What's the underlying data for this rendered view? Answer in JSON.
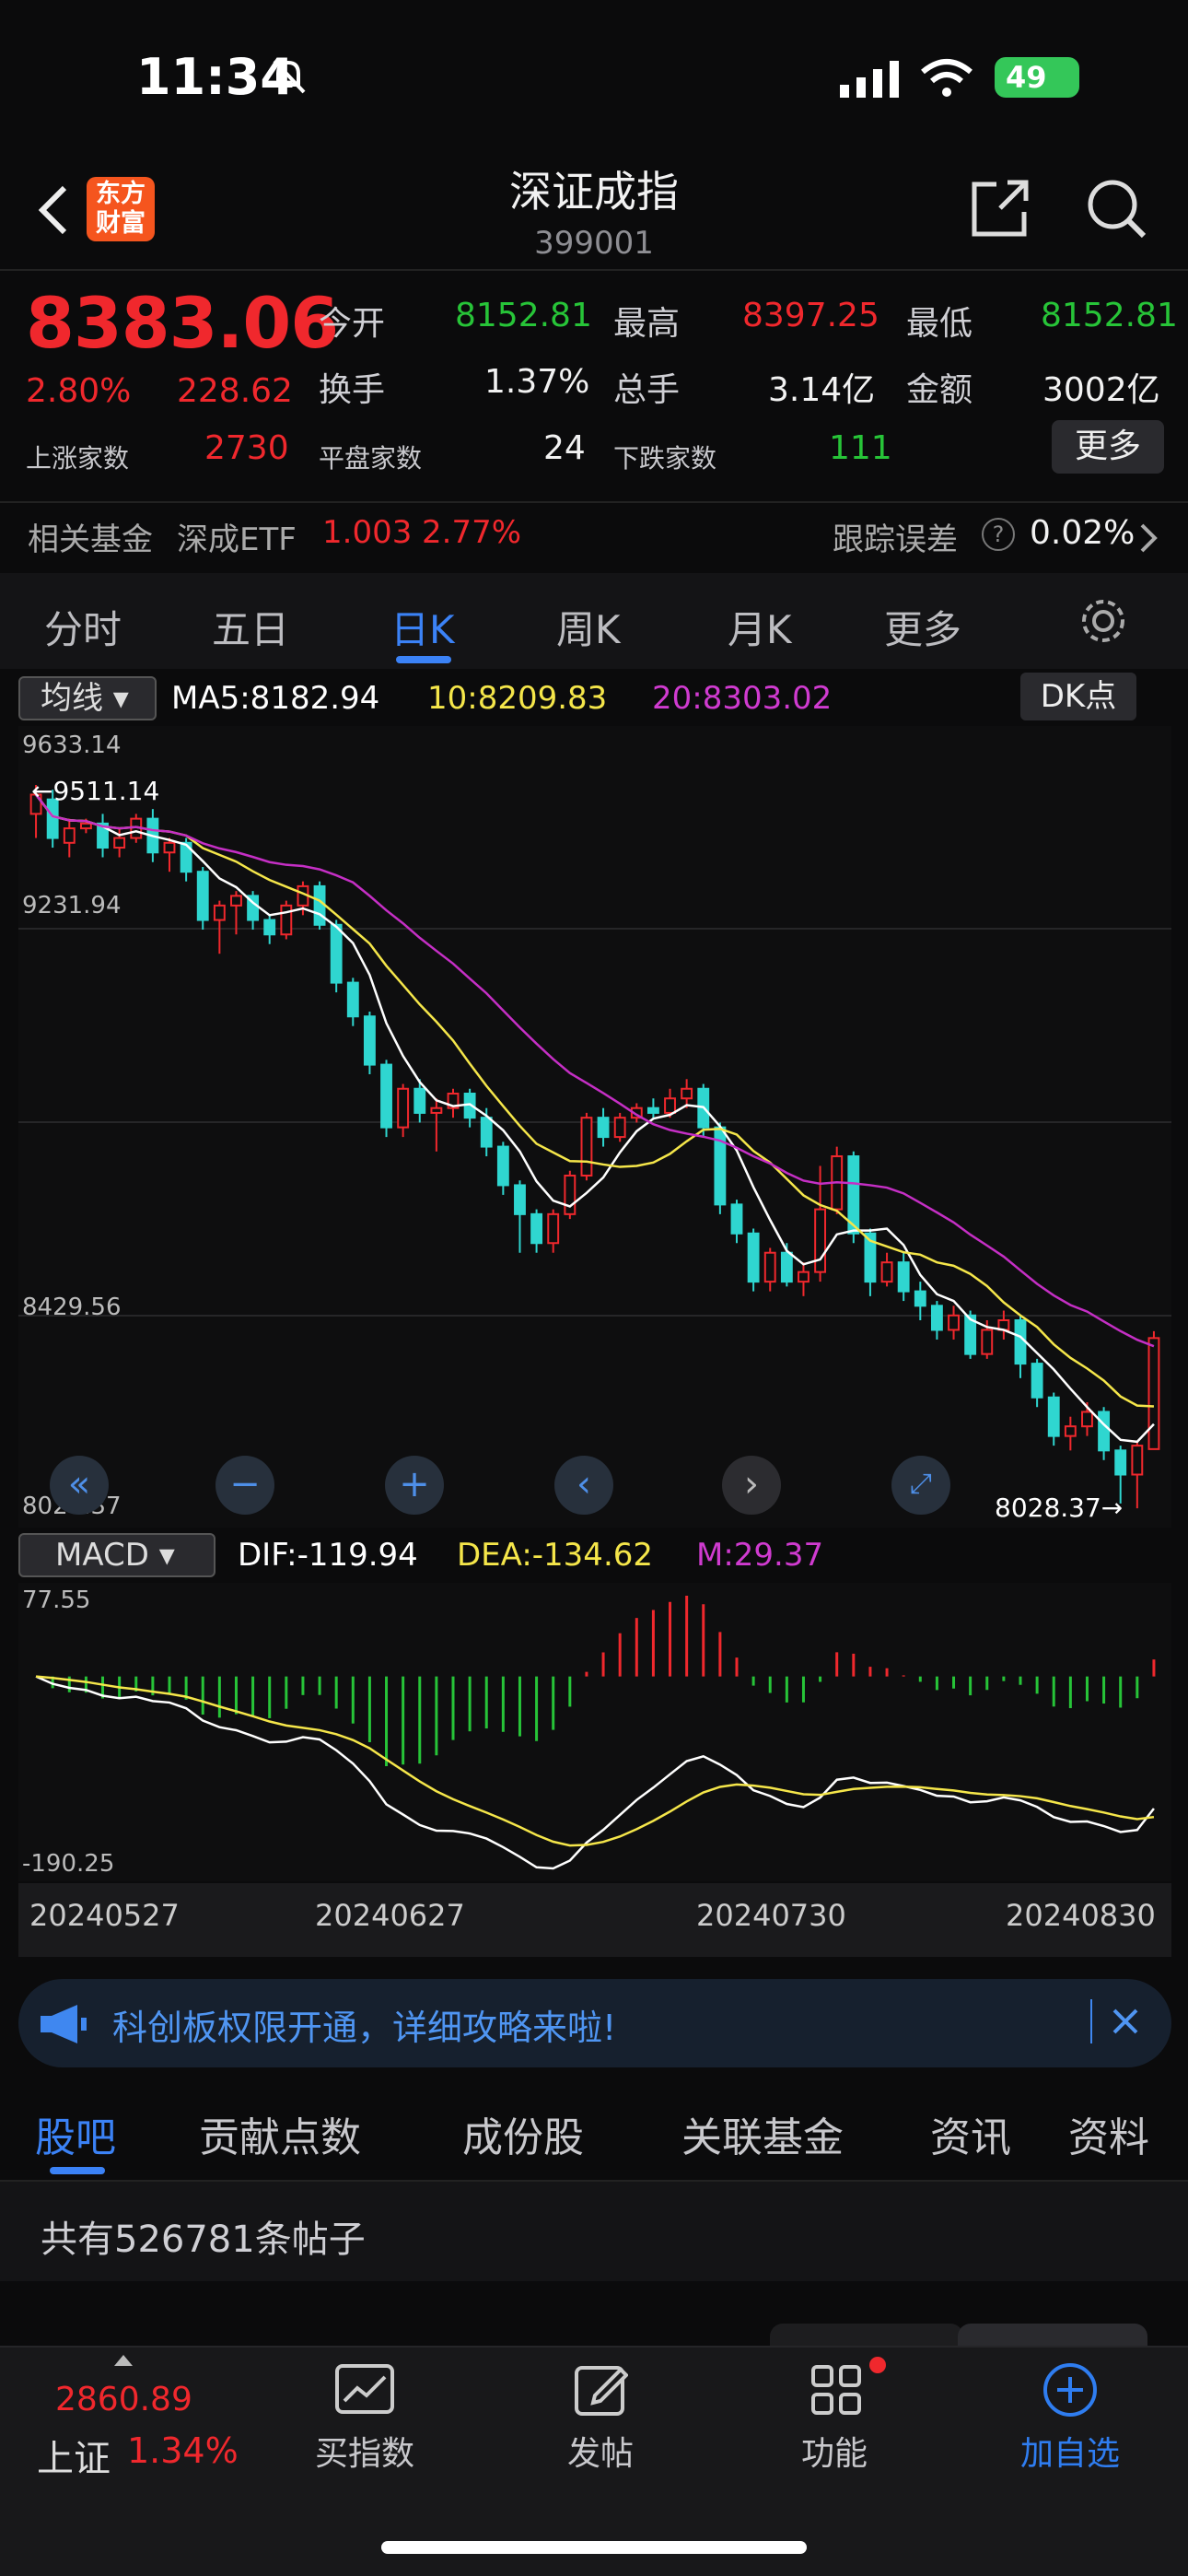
{
  "status": {
    "time": "11:34",
    "battery": "49"
  },
  "header": {
    "logo_line1": "东方",
    "logo_line2": "财富",
    "title": "深证成指",
    "code": "399001"
  },
  "quote": {
    "price": "8383.06",
    "pct": "2.80%",
    "chg": "228.62",
    "open_label": "今开",
    "open": "8152.81",
    "high_label": "最高",
    "high": "8397.25",
    "low_label": "最低",
    "low": "8152.81",
    "turnover_label": "换手",
    "turnover": "1.37%",
    "volume_label": "总手",
    "volume": "3.14亿",
    "amount_label": "金额",
    "amount": "3002亿",
    "up_label": "上涨家数",
    "up": "2730",
    "flat_label": "平盘家数",
    "flat": "24",
    "down_label": "下跌家数",
    "down": "111",
    "more_label": "更多"
  },
  "fund": {
    "label": "相关基金",
    "name": "深成ETF",
    "price": "1.003",
    "pct": "2.77%",
    "tracking_label": "跟踪误差",
    "tracking": "0.02%"
  },
  "tabs": [
    "分时",
    "五日",
    "日K",
    "周K",
    "月K",
    "更多"
  ],
  "active_tab": 2,
  "ma": {
    "selector": "均线",
    "ma5": "MA5:8182.94",
    "ma10": "10:8209.83",
    "ma20": "20:8303.02",
    "dk": "DK点"
  },
  "price_axis": {
    "top": "9633.14",
    "mid1": "9231.94",
    "mid2": "8429.56",
    "bottom": "8028.37",
    "high_marker": "9511.14",
    "low_marker": "8028.37"
  },
  "macd": {
    "selector": "MACD",
    "dif": "DIF:-119.94",
    "dea": "DEA:-134.62",
    "m": "M:29.37",
    "top": "77.55",
    "bottom": "-190.25"
  },
  "dates": [
    "20240527",
    "20240627",
    "20240730",
    "20240830"
  ],
  "banner": {
    "text": "科创板权限开通，详细攻略来啦!"
  },
  "section_tabs": [
    "股吧",
    "贡献点数",
    "成份股",
    "关联基金",
    "资讯",
    "资料"
  ],
  "posts": {
    "text": "共有526781条帖子"
  },
  "bottom_nav": {
    "index_price": "2860.89",
    "index_name": "上证",
    "index_pct": "1.34%",
    "items": [
      "买指数",
      "发帖",
      "功能",
      "加自选"
    ]
  },
  "colors": {
    "up": "#f0282d",
    "down": "#27c438",
    "candle_down": "#2fd6d0",
    "ma5": "#ffffff",
    "ma10": "#f5e64a",
    "ma20": "#c52fc5",
    "accent": "#2f7df0"
  },
  "chart_data": {
    "type": "candlestick",
    "ylim": [
      8028.37,
      9633.14
    ],
    "candles": [
      [
        9470,
        9510,
        9420,
        9530
      ],
      [
        9500,
        9420,
        9400,
        9520
      ],
      [
        9410,
        9440,
        9380,
        9460
      ],
      [
        9440,
        9450,
        9430,
        9460
      ],
      [
        9450,
        9400,
        9380,
        9470
      ],
      [
        9400,
        9420,
        9380,
        9440
      ],
      [
        9420,
        9460,
        9410,
        9470
      ],
      [
        9460,
        9390,
        9370,
        9480
      ],
      [
        9390,
        9410,
        9350,
        9420
      ],
      [
        9410,
        9350,
        9330,
        9420
      ],
      [
        9350,
        9250,
        9230,
        9360
      ],
      [
        9250,
        9280,
        9180,
        9290
      ],
      [
        9280,
        9300,
        9220,
        9310
      ],
      [
        9300,
        9250,
        9230,
        9310
      ],
      [
        9250,
        9220,
        9200,
        9260
      ],
      [
        9220,
        9280,
        9210,
        9290
      ],
      [
        9280,
        9320,
        9260,
        9330
      ],
      [
        9320,
        9240,
        9230,
        9330
      ],
      [
        9240,
        9120,
        9100,
        9250
      ],
      [
        9120,
        9050,
        9030,
        9130
      ],
      [
        9050,
        8950,
        8930,
        9060
      ],
      [
        8950,
        8820,
        8800,
        8960
      ],
      [
        8820,
        8900,
        8800,
        8910
      ],
      [
        8900,
        8850,
        8830,
        8920
      ],
      [
        8850,
        8860,
        8770,
        8880
      ],
      [
        8860,
        8890,
        8840,
        8900
      ],
      [
        8890,
        8840,
        8820,
        8900
      ],
      [
        8840,
        8780,
        8760,
        8860
      ],
      [
        8780,
        8700,
        8680,
        8790
      ],
      [
        8700,
        8640,
        8560,
        8710
      ],
      [
        8640,
        8580,
        8560,
        8650
      ],
      [
        8580,
        8640,
        8560,
        8650
      ],
      [
        8640,
        8720,
        8630,
        8730
      ],
      [
        8720,
        8840,
        8710,
        8850
      ],
      [
        8840,
        8800,
        8780,
        8860
      ],
      [
        8800,
        8840,
        8790,
        8850
      ],
      [
        8840,
        8860,
        8830,
        8870
      ],
      [
        8860,
        8850,
        8840,
        8880
      ],
      [
        8850,
        8880,
        8840,
        8900
      ],
      [
        8880,
        8900,
        8860,
        8920
      ],
      [
        8900,
        8820,
        8800,
        8910
      ],
      [
        8820,
        8660,
        8640,
        8830
      ],
      [
        8660,
        8600,
        8580,
        8670
      ],
      [
        8600,
        8500,
        8480,
        8610
      ],
      [
        8500,
        8560,
        8480,
        8570
      ],
      [
        8560,
        8500,
        8490,
        8580
      ],
      [
        8500,
        8520,
        8470,
        8540
      ],
      [
        8520,
        8650,
        8500,
        8740
      ],
      [
        8650,
        8760,
        8640,
        8780
      ],
      [
        8760,
        8600,
        8580,
        8770
      ],
      [
        8600,
        8500,
        8470,
        8610
      ],
      [
        8500,
        8540,
        8490,
        8560
      ],
      [
        8540,
        8480,
        8460,
        8560
      ],
      [
        8480,
        8450,
        8420,
        8500
      ],
      [
        8450,
        8400,
        8380,
        8460
      ],
      [
        8400,
        8430,
        8380,
        8450
      ],
      [
        8430,
        8350,
        8340,
        8440
      ],
      [
        8350,
        8400,
        8340,
        8420
      ],
      [
        8400,
        8420,
        8380,
        8440
      ],
      [
        8420,
        8330,
        8300,
        8430
      ],
      [
        8330,
        8260,
        8240,
        8340
      ],
      [
        8260,
        8180,
        8160,
        8270
      ],
      [
        8180,
        8200,
        8150,
        8220
      ],
      [
        8200,
        8230,
        8180,
        8250
      ],
      [
        8230,
        8150,
        8130,
        8240
      ],
      [
        8150,
        8100,
        8040,
        8160
      ],
      [
        8100,
        8160,
        8030,
        8170
      ],
      [
        8152.81,
        8383.06,
        8152.81,
        8397.25
      ]
    ]
  }
}
